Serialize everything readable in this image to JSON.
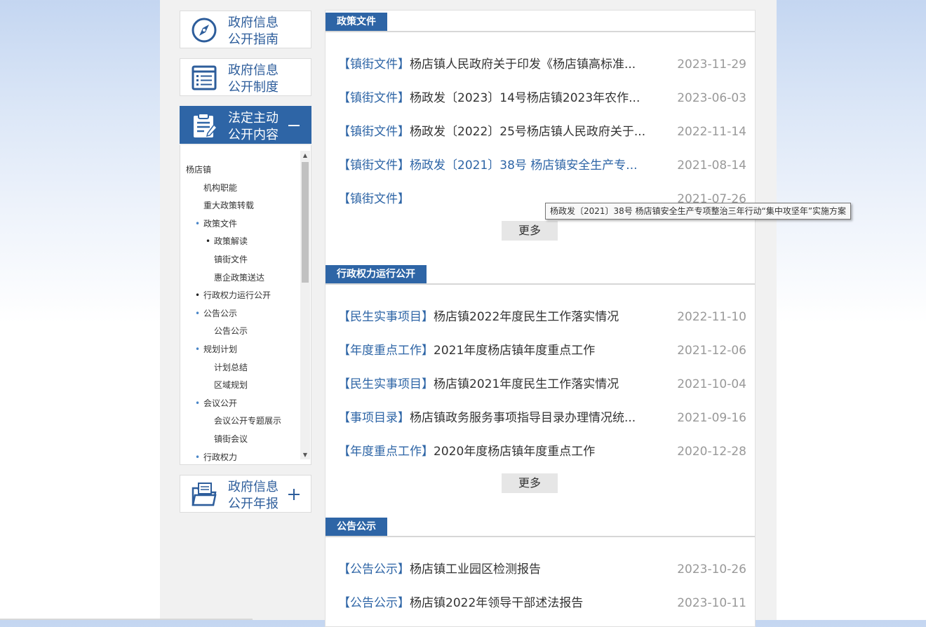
{
  "sidebar": {
    "cards": [
      {
        "line1": "政府信息",
        "line2": "公开指南",
        "icon": "compass-icon"
      },
      {
        "line1": "政府信息",
        "line2": "公开制度",
        "icon": "list-document-icon"
      },
      {
        "line1": "法定主动",
        "line2": "公开内容",
        "icon": "clipboard-icon",
        "toggle": "minus-icon"
      },
      {
        "line1": "政府信息",
        "line2": "公开年报",
        "icon": "folder-document-icon",
        "toggle": "plus-icon"
      }
    ],
    "tree": [
      {
        "label": "杨店镇",
        "level": 0,
        "bullet": ""
      },
      {
        "label": "机构职能",
        "level": 1,
        "bullet": ""
      },
      {
        "label": "重大政策转载",
        "level": 1,
        "bullet": ""
      },
      {
        "label": "政策文件",
        "level": 1,
        "bullet": "blue"
      },
      {
        "label": "政策解读",
        "level": 2,
        "bullet": "black"
      },
      {
        "label": "镇街文件",
        "level": 2,
        "bullet": ""
      },
      {
        "label": "惠企政策送达",
        "level": 2,
        "bullet": ""
      },
      {
        "label": "行政权力运行公开",
        "level": 1,
        "bullet": "black"
      },
      {
        "label": "公告公示",
        "level": 1,
        "bullet": "blue"
      },
      {
        "label": "公告公示",
        "level": 2,
        "bullet": ""
      },
      {
        "label": "规划计划",
        "level": 1,
        "bullet": "blue"
      },
      {
        "label": "计划总结",
        "level": 2,
        "bullet": ""
      },
      {
        "label": "区域规划",
        "level": 2,
        "bullet": ""
      },
      {
        "label": "会议公开",
        "level": 1,
        "bullet": "blue"
      },
      {
        "label": "会议公开专题展示",
        "level": 2,
        "bullet": ""
      },
      {
        "label": "镇街会议",
        "level": 2,
        "bullet": ""
      },
      {
        "label": "行政权力",
        "level": 1,
        "bullet": "blue"
      }
    ]
  },
  "sections": [
    {
      "title": "政策文件",
      "more_label": "更多",
      "rows": [
        {
          "tag": "【镇街文件】",
          "title": "杨店镇人民政府关于印发《杨店镇高标准...",
          "date": "2023-11-29"
        },
        {
          "tag": "【镇街文件】",
          "title": "杨政发〔2023〕14号杨店镇2023年农作...",
          "date": "2023-06-03"
        },
        {
          "tag": "【镇街文件】",
          "title": "杨政发〔2022〕25号杨店镇人民政府关于...",
          "date": "2022-11-14"
        },
        {
          "tag": "【镇街文件】",
          "title": "杨政发〔2021〕38号 杨店镇安全生产专...",
          "date": "2021-08-14"
        },
        {
          "tag": "【镇街文件】",
          "title": "",
          "date": "2021-07-26"
        }
      ]
    },
    {
      "title": "行政权力运行公开",
      "more_label": "更多",
      "rows": [
        {
          "tag": "【民生实事项目】",
          "title": "杨店镇2022年度民生工作落实情况",
          "date": "2022-11-10"
        },
        {
          "tag": "【年度重点工作】",
          "title": "2021年度杨店镇年度重点工作",
          "date": "2021-12-06"
        },
        {
          "tag": "【民生实事项目】",
          "title": "杨店镇2021年度民生工作落实情况",
          "date": "2021-10-04"
        },
        {
          "tag": "【事项目录】",
          "title": "杨店镇政务服务事项指导目录办理情况统...",
          "date": "2021-09-16"
        },
        {
          "tag": "【年度重点工作】",
          "title": "2020年度杨店镇年度重点工作",
          "date": "2020-12-28"
        }
      ]
    },
    {
      "title": "公告公示",
      "rows": [
        {
          "tag": "【公告公示】",
          "title": "杨店镇工业园区检测报告",
          "date": "2023-10-26"
        },
        {
          "tag": "【公告公示】",
          "title": "杨店镇2022年领导干部述法报告",
          "date": "2023-10-11"
        }
      ]
    }
  ],
  "tooltip": "杨政发〔2021〕38号 杨店镇安全生产专项整治三年行动“集中攻坚年”实施方案",
  "colors": {
    "brand": "#2e65a6",
    "tag": "#2e65a6",
    "date": "#999999"
  }
}
